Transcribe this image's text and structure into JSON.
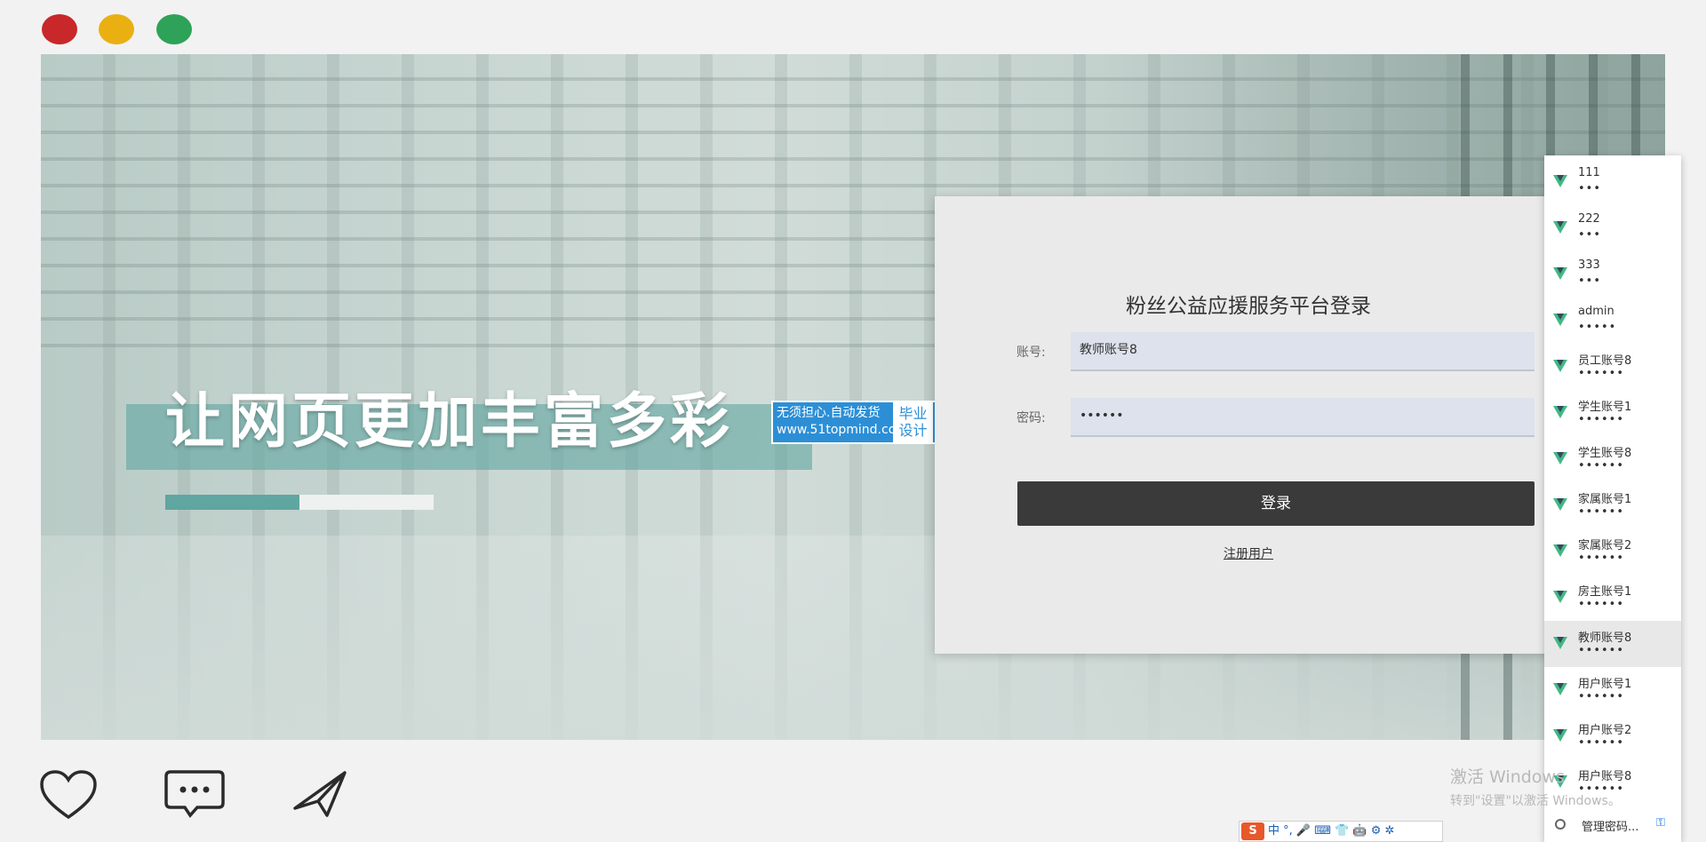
{
  "window": {
    "controls": [
      "close",
      "minimize",
      "maximize"
    ]
  },
  "hero": {
    "headline": "让网页更加丰富多彩",
    "progress": 0.5
  },
  "badge": {
    "line1": "无须担心.自动发货",
    "line2": "www.51topmind.com",
    "side": "毕业设计"
  },
  "login": {
    "title": "粉丝公益应援服务平台登录",
    "account_label": "账号:",
    "account_value": "教师账号8",
    "password_label": "密码:",
    "password_value": "••••••",
    "submit_label": "登录",
    "register_label": "注册用户"
  },
  "password_dropdown": {
    "items": [
      {
        "username": "111",
        "mask": "•••"
      },
      {
        "username": "222",
        "mask": "•••"
      },
      {
        "username": "333",
        "mask": "•••"
      },
      {
        "username": "admin",
        "mask": "•••••"
      },
      {
        "username": "员工账号8",
        "mask": "••••••"
      },
      {
        "username": "学生账号1",
        "mask": "••••••"
      },
      {
        "username": "学生账号8",
        "mask": "••••••"
      },
      {
        "username": "家属账号1",
        "mask": "••••••"
      },
      {
        "username": "家属账号2",
        "mask": "••••••"
      },
      {
        "username": "房主账号1",
        "mask": "••••••"
      },
      {
        "username": "教师账号8",
        "mask": "••••••",
        "highlighted": true
      },
      {
        "username": "用户账号1",
        "mask": "••••••"
      },
      {
        "username": "用户账号2",
        "mask": "••••••"
      },
      {
        "username": "用户账号8",
        "mask": "••••••"
      }
    ],
    "manage_label": "管理密码..."
  },
  "watermark": {
    "line1": "激活 Windows",
    "line2": "转到\"设置\"以激活 Windows。"
  },
  "bottom_icons": [
    "heart-icon",
    "comment-icon",
    "send-icon"
  ],
  "ime": {
    "logo": "S",
    "text": "中 °, 🎤 ⌨ 👕 🤖 ⚙ ✲"
  }
}
